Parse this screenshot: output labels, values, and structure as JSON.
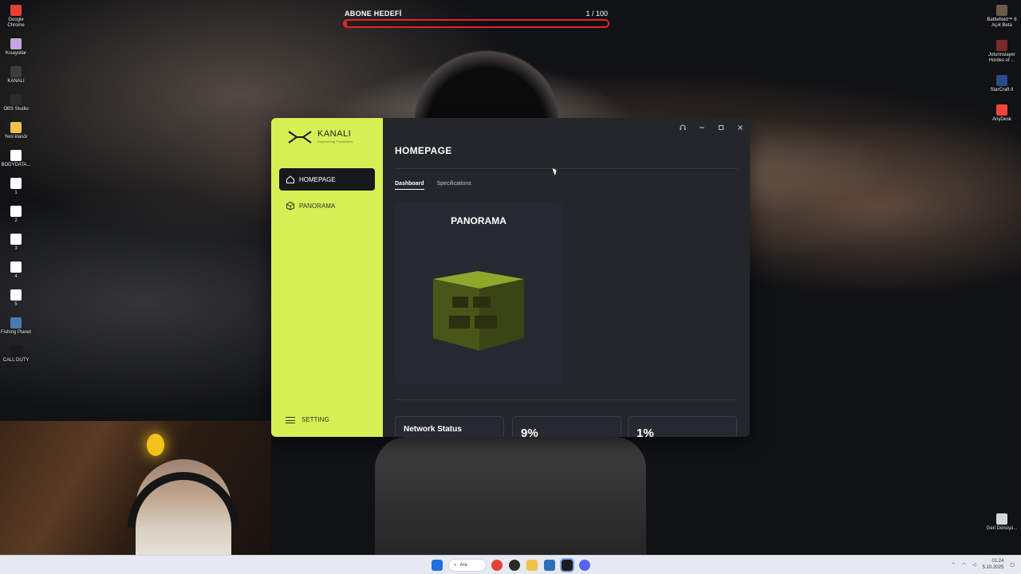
{
  "overlay": {
    "goal_label": "ABONE HEDEFİ",
    "goal_count": "1  /  100",
    "goal_progress": 0.01
  },
  "desktop_left": [
    {
      "name": "Google Chrome",
      "icon": "chrome-icon",
      "color": "#e44134"
    },
    {
      "name": "Kısayollar",
      "icon": "shortcut-icon",
      "color": "#c7a6e0"
    },
    {
      "name": "KANALI",
      "icon": "folder-icon",
      "color": "#3c3c3c"
    },
    {
      "name": "OBS Studio",
      "icon": "obs-icon",
      "color": "#2b2b2b"
    },
    {
      "name": "Yeni klasör",
      "icon": "folder-icon",
      "color": "#f0c24b"
    },
    {
      "name": "BODYDATA...",
      "icon": "file-icon",
      "color": "#ffffff"
    },
    {
      "name": "1",
      "icon": "file-icon",
      "color": "#ffffff"
    },
    {
      "name": "2",
      "icon": "file-icon",
      "color": "#ffffff"
    },
    {
      "name": "3",
      "icon": "file-icon",
      "color": "#ffffff"
    },
    {
      "name": "4",
      "icon": "file-icon",
      "color": "#ffffff"
    },
    {
      "name": "5",
      "icon": "file-icon",
      "color": "#ffffff"
    },
    {
      "name": "Fishing Planet",
      "icon": "game-icon",
      "color": "#4a7bb0"
    },
    {
      "name": "CALL DUTY",
      "icon": "game-icon",
      "color": "#1a1a1a"
    }
  ],
  "desktop_right": [
    {
      "name": "Battlefield™ 6 Açık Beta",
      "icon": "game-icon",
      "color": "#6b5a48"
    },
    {
      "name": "Jotunnslayer Hordes of ...",
      "icon": "game-icon",
      "color": "#7a2a2a"
    },
    {
      "name": "StarCraft II",
      "icon": "game-icon",
      "color": "#2a4a8a"
    },
    {
      "name": "AnyDesk",
      "icon": "anydesk-icon",
      "color": "#ef443b"
    }
  ],
  "recycle_bin": {
    "name": "Geri Dönüşü...",
    "icon": "recycle-bin-icon"
  },
  "app": {
    "brand": "KANALI",
    "tagline": "Empowering Possibilities",
    "nav": [
      {
        "label": "HOMEPAGE",
        "icon": "home-icon",
        "active": true
      },
      {
        "label": "PANORAMA",
        "icon": "box-icon",
        "active": false
      }
    ],
    "setting_label": "SETTING",
    "page_title": "HOMEPAGE",
    "tabs": [
      {
        "label": "Dashboard",
        "active": true
      },
      {
        "label": "Specifications",
        "active": false
      }
    ],
    "card_title": "PANORAMA",
    "stats": [
      {
        "label": "Network Status"
      },
      {
        "value": "9%"
      },
      {
        "value": "1%"
      }
    ],
    "window_buttons": [
      "headset-icon",
      "minimize-icon",
      "maximize-icon",
      "close-icon"
    ]
  },
  "taskbar": {
    "search_placeholder": "Ara",
    "time": "01:24",
    "date": "5.10.2025"
  },
  "colors": {
    "accent": "#d6ef55",
    "window_bg": "#23262b",
    "goal_red": "#e3242b"
  }
}
